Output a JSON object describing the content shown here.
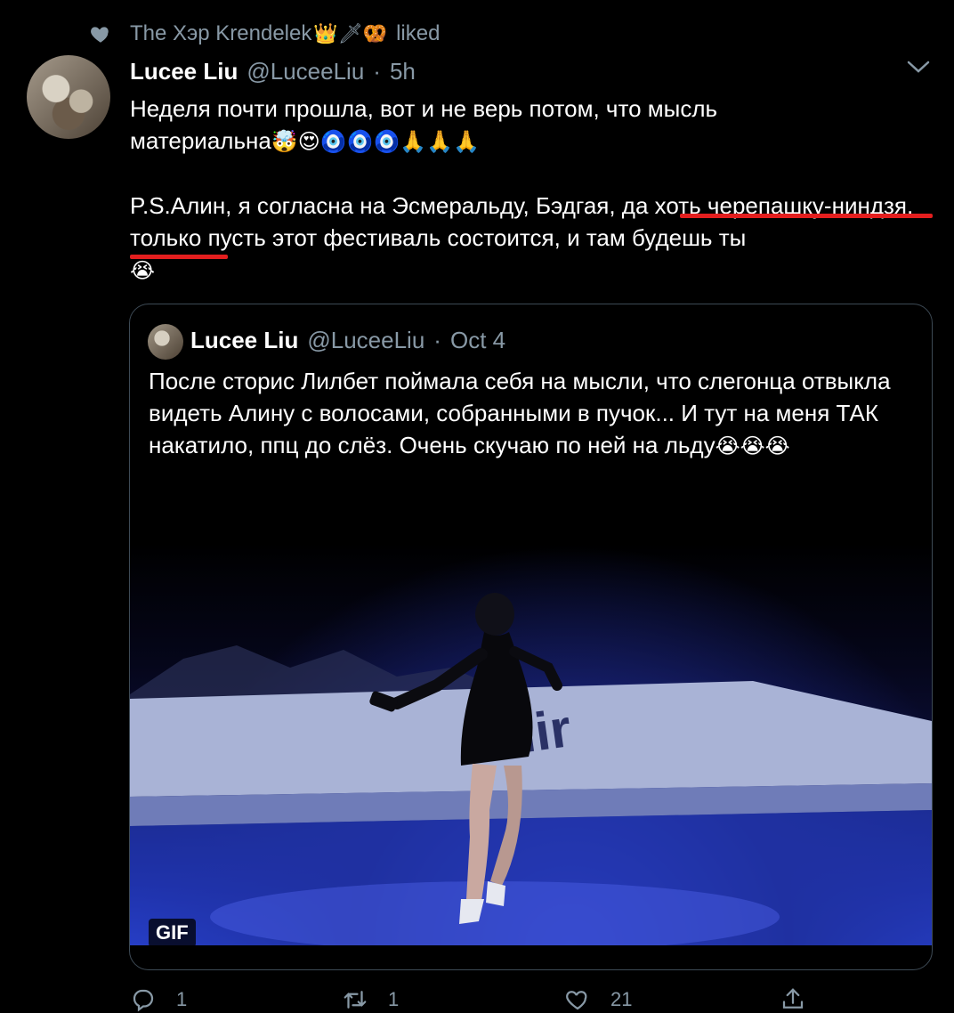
{
  "social_context": {
    "user": "The Хэр Krendelek",
    "user_emoji": "👑🗡🥨",
    "action": "liked"
  },
  "tweet": {
    "author_name": "Lucee Liu",
    "author_handle": "@LuceeLiu",
    "separator": "·",
    "time": "5h",
    "text_line1": "Неделя почти прошла, вот и не верь потом, что мысль",
    "text_line2_prefix": "материальна",
    "text_line2_emoji": "🤯😍🧿🧿🧿🙏🙏🙏",
    "text_para2": "P.S.Алин, я согласна на Эсмеральду, Бэдгая, да хоть черепашку-ниндзя, только пусть этот фестиваль состоится, и там будешь ты",
    "text_para2_emoji": "😭"
  },
  "quoted": {
    "author_name": "Lucee Liu",
    "author_handle": "@LuceeLiu",
    "separator": "·",
    "time": "Oct 4",
    "text": "После сторис Лилбет поймала себя на мысли, что слегонца отвыкла видеть Алину с волосами, собранными в пучок... И тут на меня ТАК накатило, ппц до слёз. Очень скучаю по ней на льду",
    "text_emoji": "😭😭😭",
    "media_badge": "GIF"
  },
  "actions": {
    "reply_count": "1",
    "retweet_count": "1",
    "like_count": "21"
  },
  "colors": {
    "background": "#000000",
    "secondary_text": "#8899a6",
    "underline": "#e31e1e"
  }
}
